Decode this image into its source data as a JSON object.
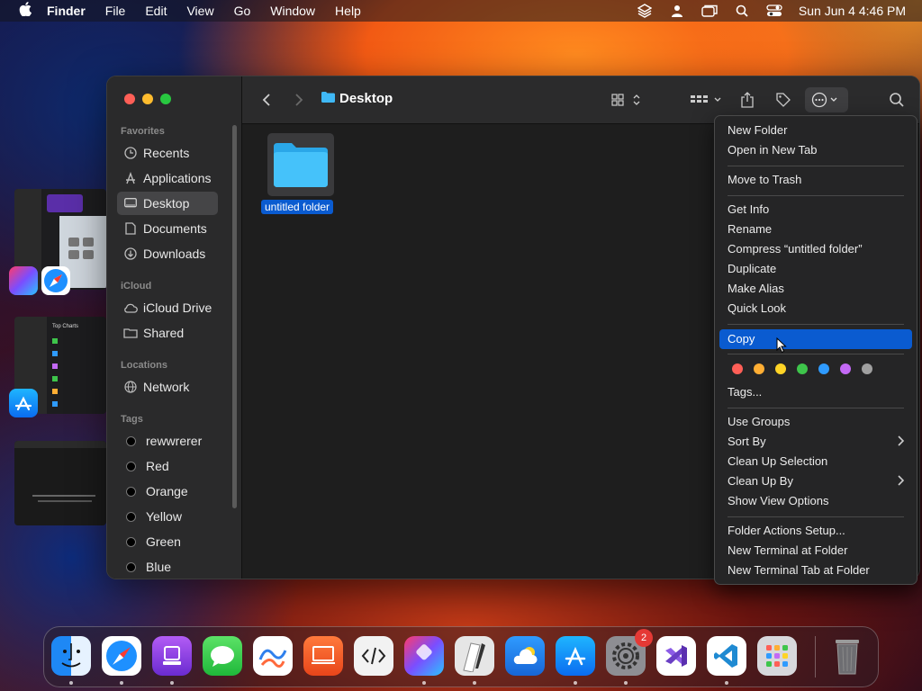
{
  "menubar": {
    "app_name": "Finder",
    "menus": [
      "File",
      "Edit",
      "View",
      "Go",
      "Window",
      "Help"
    ],
    "clock": "Sun Jun 4  4:46 PM",
    "status_icons": [
      "layers-icon",
      "user-icon",
      "window-icon",
      "search-icon",
      "control-center-icon"
    ]
  },
  "window": {
    "title": "Desktop",
    "sidebar": {
      "sections": [
        {
          "label": "Favorites",
          "items": [
            {
              "label": "Recents",
              "icon": "clock-icon"
            },
            {
              "label": "Applications",
              "icon": "applications-icon"
            },
            {
              "label": "Desktop",
              "icon": "desktop-icon",
              "selected": true
            },
            {
              "label": "Documents",
              "icon": "document-icon"
            },
            {
              "label": "Downloads",
              "icon": "download-icon"
            }
          ]
        },
        {
          "label": "iCloud",
          "items": [
            {
              "label": "iCloud Drive",
              "icon": "cloud-icon"
            },
            {
              "label": "Shared",
              "icon": "shared-folder-icon"
            }
          ]
        },
        {
          "label": "Locations",
          "items": [
            {
              "label": "Network",
              "icon": "globe-icon"
            }
          ]
        },
        {
          "label": "Tags",
          "items": [
            {
              "label": "rewwrerer"
            },
            {
              "label": "Red"
            },
            {
              "label": "Orange"
            },
            {
              "label": "Yellow"
            },
            {
              "label": "Green"
            },
            {
              "label": "Blue"
            }
          ]
        }
      ]
    },
    "file": {
      "label": "untitled folder"
    }
  },
  "context_menu": {
    "items": {
      "new_folder": "New Folder",
      "open_new_tab": "Open in New Tab",
      "move_to_trash": "Move to Trash",
      "get_info": "Get Info",
      "rename": "Rename",
      "compress": "Compress “untitled folder”",
      "duplicate": "Duplicate",
      "make_alias": "Make Alias",
      "quick_look": "Quick Look",
      "copy": "Copy",
      "tags": "Tags...",
      "use_groups": "Use Groups",
      "sort_by": "Sort By",
      "clean_up_selection": "Clean Up Selection",
      "clean_up_by": "Clean Up By",
      "show_view_options": "Show View Options",
      "folder_actions": "Folder Actions Setup...",
      "new_terminal": "New Terminal at Folder",
      "new_terminal_tab": "New Terminal Tab at Folder"
    },
    "highlighted": "Copy",
    "tag_colors": [
      "#ff5f57",
      "#ffae34",
      "#ffd426",
      "#3ec54b",
      "#2f9bff",
      "#c369f5",
      "#a0a0a0"
    ]
  },
  "stage_manager": {
    "thumb2_title": "Top Charts"
  },
  "dock": {
    "apps": [
      "finder-icon",
      "safari-icon",
      "podcasts-icon",
      "messages-icon",
      "freeform-icon",
      "presentation-icon",
      "code-editor-icon",
      "shortcuts-icon",
      "script-editor-icon",
      "weather-icon",
      "app-store-icon",
      "system-settings-icon",
      "visual-studio-icon",
      "vscode-icon",
      "launchpad-icon",
      "trash-icon"
    ],
    "settings_badge": "2"
  },
  "colors": {
    "accent": "#0a5bd0",
    "folder": "#3fb8f5"
  }
}
